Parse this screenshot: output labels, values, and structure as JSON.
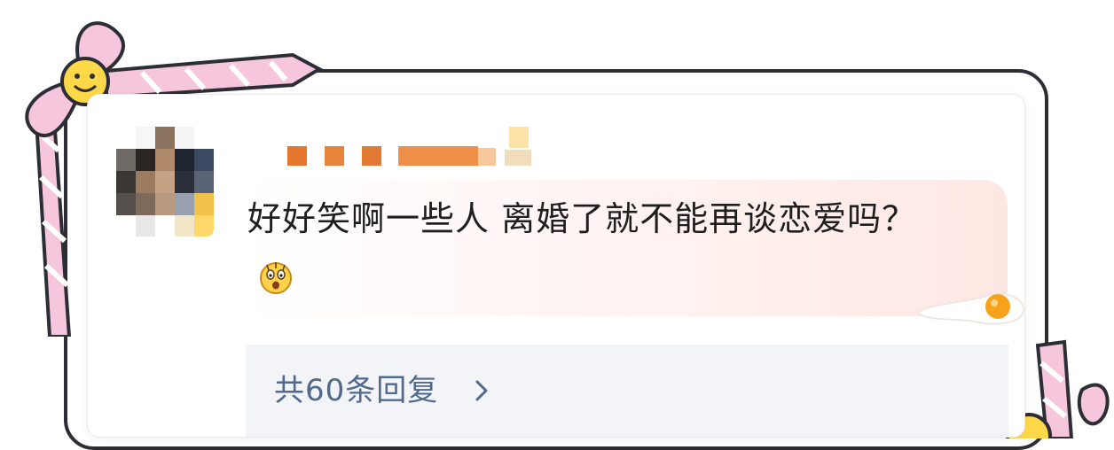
{
  "comment": {
    "text": "好好笑啊一些人 离婚了就不能再谈恋爱吗？",
    "emoji_icon": "shocked-face-icon"
  },
  "replies": {
    "label": "共60条回复"
  },
  "user": {
    "username_obscured": true
  },
  "decor": {
    "ribbon_color": "#f6c6dc",
    "ribbon_stroke": "#2d2d36",
    "smiley_color": "#ffd84a",
    "frame_color": "#2d2d36",
    "reply_link_color": "#50698c"
  }
}
